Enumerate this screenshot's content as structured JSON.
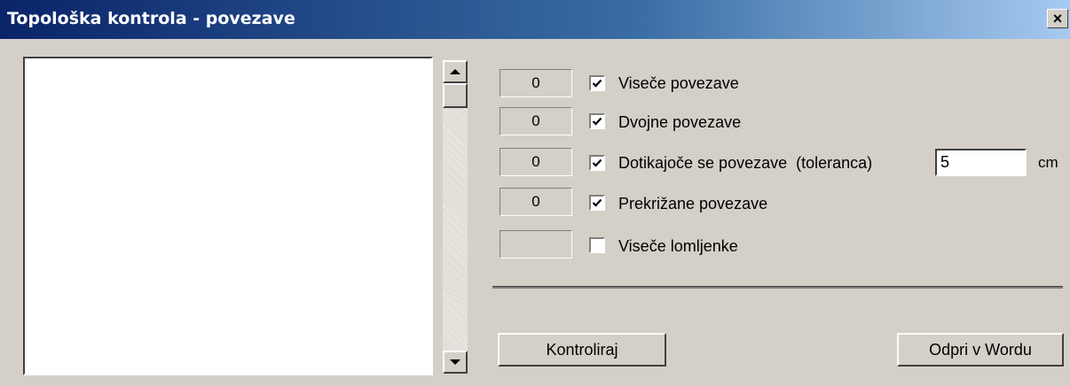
{
  "window": {
    "title": "Topološka kontrola - povezave",
    "close_glyph": "×"
  },
  "checks": [
    {
      "count": "0",
      "label": "Viseče povezave",
      "checked": true
    },
    {
      "count": "0",
      "label": "Dvojne povezave",
      "checked": true
    },
    {
      "count": "0",
      "label": "Dotikajoče se povezave  (toleranca)",
      "checked": true
    },
    {
      "count": "0",
      "label": "Prekrižane povezave",
      "checked": true
    },
    {
      "count": "",
      "label": "Viseče lomljenke",
      "checked": false
    }
  ],
  "tolerance": {
    "value": "5",
    "unit": "cm"
  },
  "buttons": {
    "run": "Kontroliraj",
    "open_word": "Odpri v Wordu"
  },
  "icons": {
    "close": "close-icon",
    "scroll_up": "chevron-up-icon",
    "scroll_down": "chevron-down-icon",
    "check": "checkmark-icon"
  }
}
